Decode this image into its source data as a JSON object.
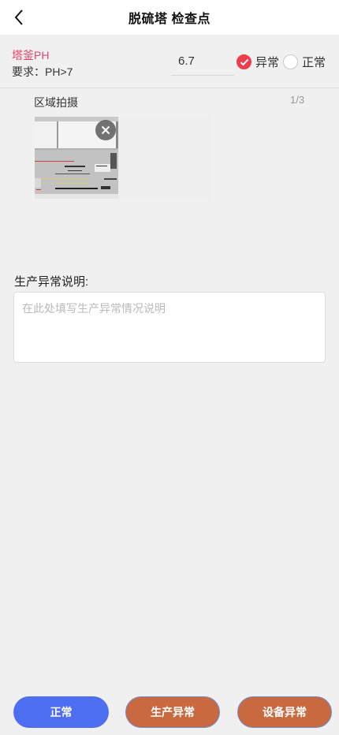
{
  "header": {
    "title": "脱硫塔 检查点",
    "back_icon": "chevron-left-icon"
  },
  "check_item": {
    "name": "塔釜PH",
    "requirement": "要求：PH>7",
    "value": "6.7",
    "options": [
      {
        "label": "异常",
        "checked": true
      },
      {
        "label": "正常",
        "checked": false
      }
    ],
    "name_color": "#e8436a",
    "checked_color": "#ee3d4d"
  },
  "photo": {
    "title": "区域拍摄",
    "count": "1/3"
  },
  "description": {
    "label": "生产异常说明:",
    "placeholder": "在此处填写生产异常情况说明"
  },
  "buttons": {
    "normal": "正常",
    "production_abnormal": "生产异常",
    "equipment_abnormal": "设备异常",
    "normal_color": "#4e6ef2",
    "abnormal_color": "#c8693f"
  }
}
